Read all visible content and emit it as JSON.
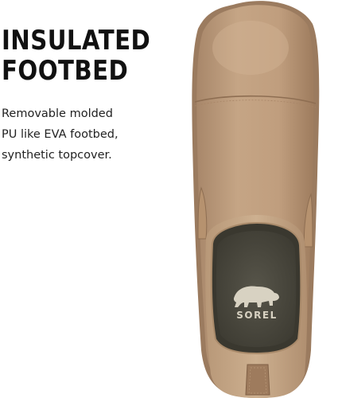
{
  "headline": {
    "line1": "INSULATED",
    "line2": "FOOTBED"
  },
  "description": {
    "line1": "Removable molded",
    "line2": "PU like EVA footbed,",
    "line3": "synthetic topcover."
  },
  "product_image": {
    "subject": "boot-top-view",
    "logo_text": "SOREL",
    "colors": {
      "leather": "#c1a07f",
      "leather_dark": "#a88565",
      "suede": "#c8a888",
      "footbed": "#4e4c40",
      "logo": "#d8d2c2"
    }
  }
}
